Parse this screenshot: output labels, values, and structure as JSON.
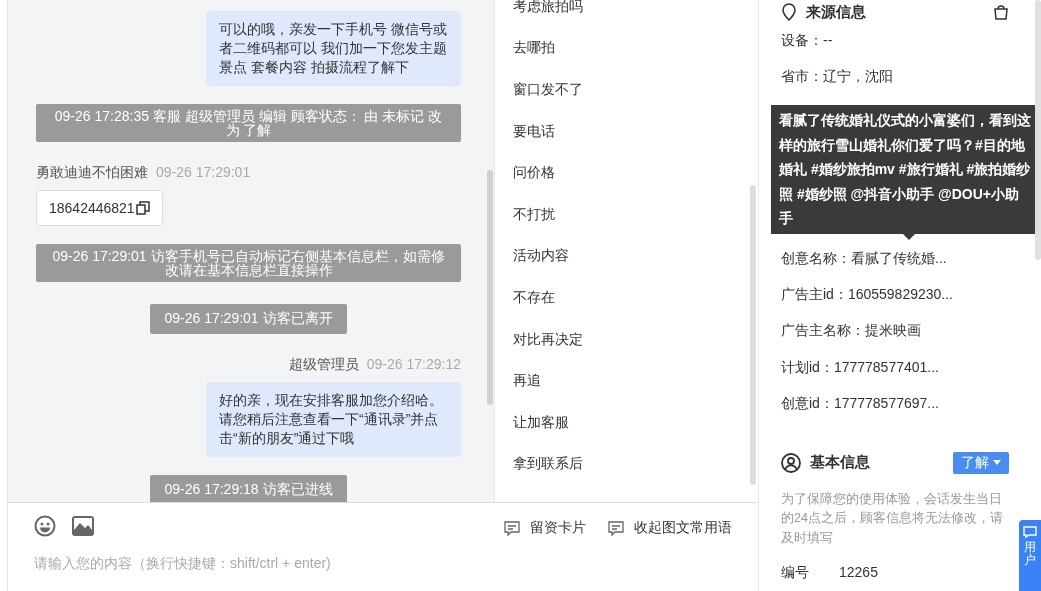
{
  "chat": {
    "messages": [
      {
        "kind": "outgoing",
        "text": "可以的哦，亲发一下手机号 微信号或者二维码都可以 我们加一下您发主题景点 套餐内容 拍摄流程了解下"
      },
      {
        "kind": "notice",
        "text": "09-26 17:28:35 客服 超级管理员 编辑 顾客状态： 由 未标记 改为 了解"
      },
      {
        "kind": "incoming",
        "sender": "勇敢迪迪不怕困难",
        "time": "09-26 17:29:01",
        "card": "18642446821"
      },
      {
        "kind": "notice",
        "text": "09-26 17:29:01 访客手机号已自动标记右侧基本信息栏，如需修改请在基本信息栏直接操作"
      },
      {
        "kind": "event",
        "text": "09-26 17:29:01 访客已离开"
      },
      {
        "kind": "outgoing",
        "sender": "超级管理员",
        "time": "09-26 17:29:12",
        "text": "好的亲，现在安排客服加您介绍哈。请您稍后注意查看一下“通讯录”并点击“新的朋友”通过下哦"
      },
      {
        "kind": "event",
        "text": "09-26 17:29:18 访客已进线"
      }
    ]
  },
  "phrases": [
    "考虑旅拍吗",
    "去哪拍",
    "窗口发不了",
    "要电话",
    "问价格",
    "不打扰",
    "活动内容",
    "不存在",
    "对比再决定",
    "再追",
    "让加客服",
    "拿到联系后"
  ],
  "composer": {
    "placeholder": "请输入您的内容（换行快捷键：shift/ctrl + enter)",
    "actions": [
      "留资卡片",
      "收起图文常用语"
    ]
  },
  "source": {
    "title": "来源信息",
    "items": [
      {
        "kind": "row",
        "text": "设备：--"
      },
      {
        "kind": "row",
        "text": "省市：辽宁，沈阳"
      },
      {
        "kind": "tooltip",
        "text": "看腻了传统婚礼仪式的小富婆们，看到这样的旅行雪山婚礼你们爱了吗？#目的地婚礼 #婚纱旅拍mv #旅行婚礼 #旅拍婚纱照 #婚纱照 @抖音小助手 @DOU+小助手"
      },
      {
        "kind": "row",
        "text": "创意名称：看腻了传统婚..."
      },
      {
        "kind": "row",
        "text": "广告主id：160559829230..."
      },
      {
        "kind": "row",
        "text": "广告主名称：提米映画"
      },
      {
        "kind": "row",
        "text": "计划id：177778577401..."
      },
      {
        "kind": "row",
        "text": "创意id：177778577697..."
      }
    ]
  },
  "basic": {
    "title": "基本信息",
    "status": "了解",
    "note": "为了保障您的使用体验，会话发生当日的24点之后，顾客信息将无法修改，请及时填写",
    "fields": [
      {
        "label": "编号",
        "value": "12265"
      }
    ]
  },
  "float_button": {
    "label": "用户"
  }
}
